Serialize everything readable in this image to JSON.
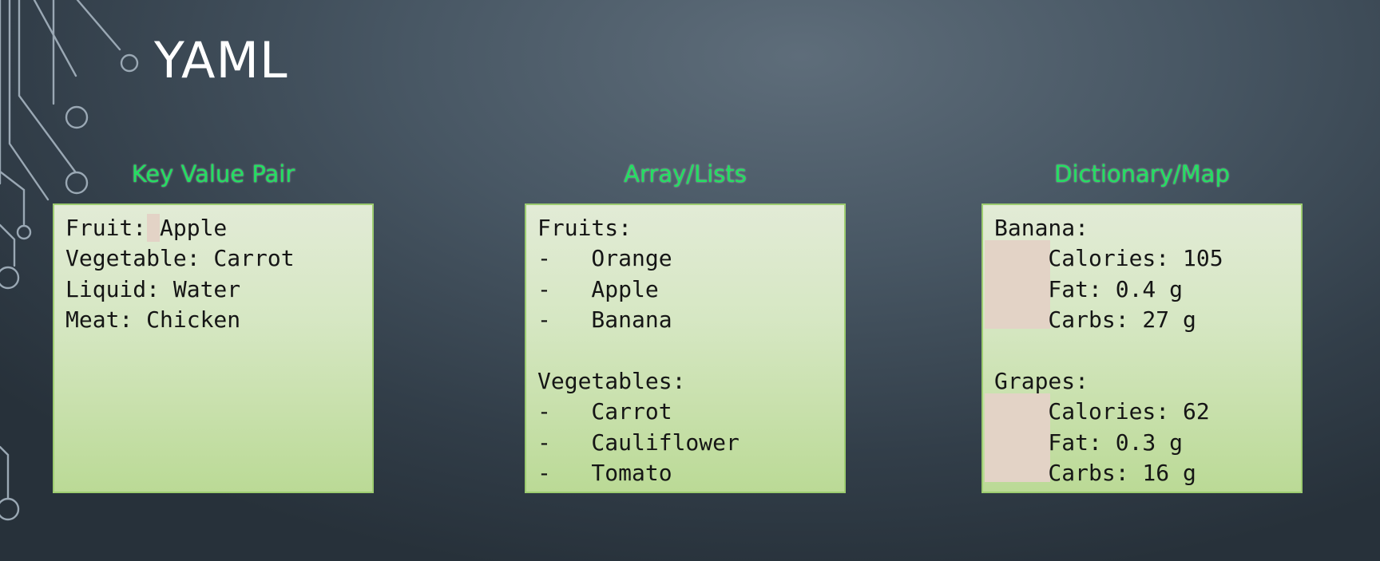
{
  "slide": {
    "title": "YAML",
    "colors": {
      "background": "#3c4853",
      "heading": "#22e060",
      "panel": "#d6e7c3",
      "panel_border": "#9dcc70",
      "highlight": "#e3d3c6",
      "circuit": "#9aa8b4"
    }
  },
  "panels": [
    {
      "heading": "Key Value Pair",
      "lines": [
        "Fruit: Apple",
        "Vegetable: Carrot",
        "Liquid: Water",
        "Meat: Chicken",
        "",
        "",
        "",
        "",
        ""
      ]
    },
    {
      "heading": "Array/Lists",
      "lines": [
        "Fruits:",
        "-   Orange",
        "-   Apple",
        "-   Banana",
        "",
        "Vegetables:",
        "-   Carrot",
        "-   Cauliflower",
        "-   Tomato"
      ]
    },
    {
      "heading": "Dictionary/Map",
      "lines": [
        "Banana:",
        "    Calories: 105",
        "    Fat: 0.4 g",
        "    Carbs: 27 g",
        "",
        "Grapes:",
        "    Calories: 62",
        "    Fat: 0.3 g",
        "    Carbs: 16 g"
      ]
    }
  ]
}
